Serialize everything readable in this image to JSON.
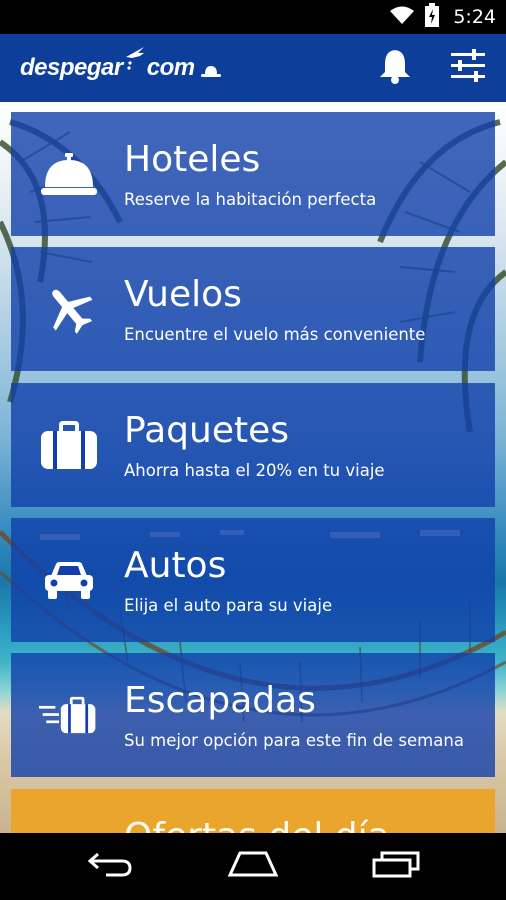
{
  "status_bar": {
    "time": "5:24",
    "icons": [
      "wifi-icon",
      "battery-charging-icon"
    ]
  },
  "app_bar": {
    "logo_text_left": "despegar",
    "logo_text_right": "com",
    "actions": [
      "bell-icon",
      "filter-sliders-icon"
    ]
  },
  "menu": [
    {
      "title": "Hoteles",
      "subtitle": "Reserve la habitación perfecta",
      "icon": "hotel-bell-icon"
    },
    {
      "title": "Vuelos",
      "subtitle": "Encuentre el vuelo más conveniente",
      "icon": "airplane-icon"
    },
    {
      "title": "Paquetes",
      "subtitle": "Ahorra hasta el 20% en tu viaje",
      "icon": "suitcase-icon"
    },
    {
      "title": "Autos",
      "subtitle": "Elija el auto para su viaje",
      "icon": "car-icon"
    },
    {
      "title": "Escapadas",
      "subtitle": "Su mejor opción para este fin de semana",
      "icon": "fast-suitcase-icon"
    }
  ],
  "offer_card": {
    "title": "Ofertas del día",
    "color": "#e9a52c"
  },
  "nav_bar": [
    "back-icon",
    "home-icon",
    "recents-icon"
  ],
  "colors": {
    "app_bar": "#0d3e9a",
    "card": "#1240aa"
  }
}
